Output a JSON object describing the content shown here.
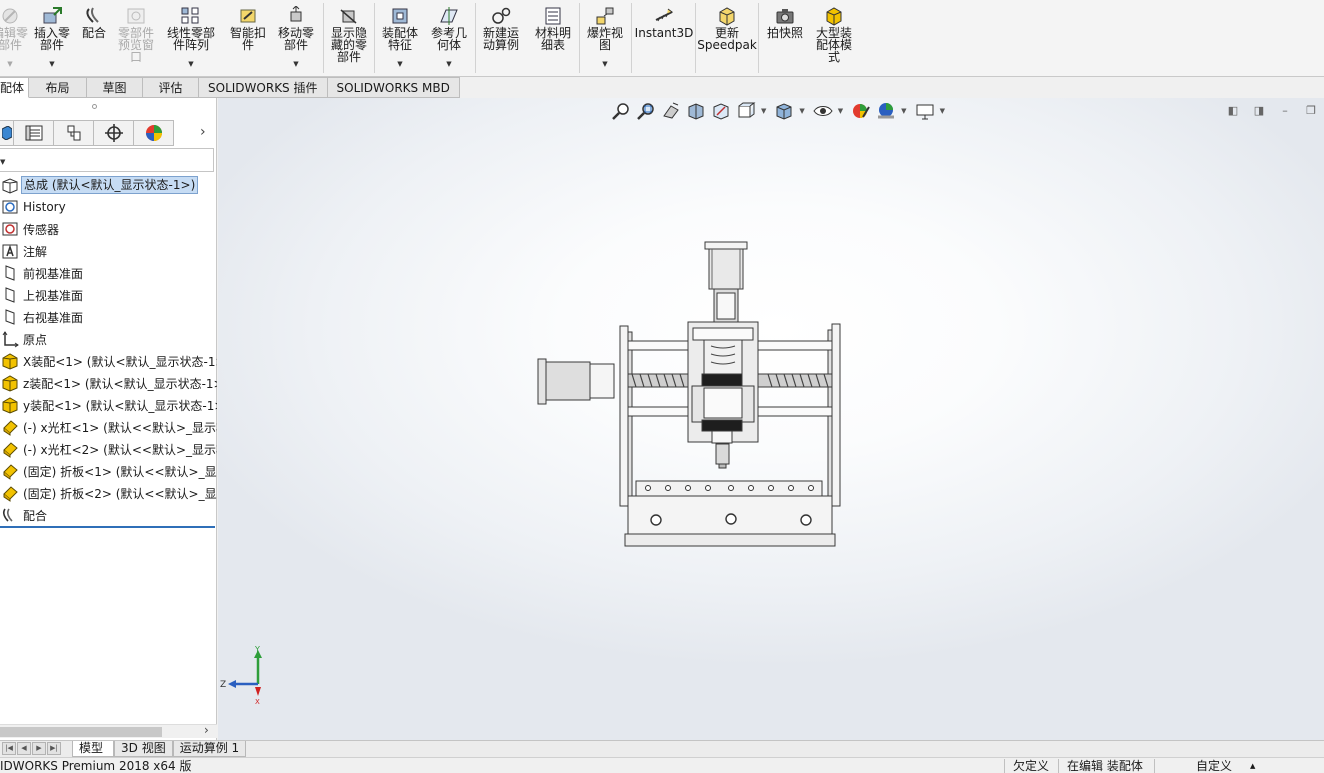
{
  "ribbon": {
    "buttons": [
      {
        "label": "编辑零\n部件",
        "icon": "edit-component-icon",
        "enabled": false
      },
      {
        "label": "插入零\n部件",
        "icon": "insert-component-icon",
        "enabled": true
      },
      {
        "label": "配合",
        "icon": "mate-icon",
        "enabled": true
      },
      {
        "label": "零部件\n预览窗\n口",
        "icon": "component-preview-icon",
        "enabled": false
      },
      {
        "label": "线性零部\n件阵列",
        "icon": "linear-pattern-icon",
        "enabled": true
      },
      {
        "label": "智能扣\n件",
        "icon": "smart-fasteners-icon",
        "enabled": true
      },
      {
        "label": "移动零\n部件",
        "icon": "move-component-icon",
        "enabled": true
      },
      {
        "label": "显示隐\n藏的零\n部件",
        "icon": "show-hidden-icon",
        "enabled": true
      },
      {
        "label": "装配体\n特征",
        "icon": "assembly-features-icon",
        "enabled": true
      },
      {
        "label": "参考几\n何体",
        "icon": "reference-geometry-icon",
        "enabled": true
      },
      {
        "label": "新建运\n动算例",
        "icon": "new-motion-study-icon",
        "enabled": true
      },
      {
        "label": "材料明\n细表",
        "icon": "bill-of-materials-icon",
        "enabled": true
      },
      {
        "label": "爆炸视\n图",
        "icon": "exploded-view-icon",
        "enabled": true
      },
      {
        "label": "Instant3D",
        "icon": "instant3d-icon",
        "enabled": true
      },
      {
        "label": "更新\nSpeedpak",
        "icon": "update-speedpak-icon",
        "enabled": true
      },
      {
        "label": "拍快照",
        "icon": "snapshot-icon",
        "enabled": true
      },
      {
        "label": "大型装\n配体模\n式",
        "icon": "large-assembly-icon",
        "enabled": true
      }
    ],
    "tabs": [
      {
        "label": "配体",
        "active": true
      },
      {
        "label": "布局",
        "active": false
      },
      {
        "label": "草图",
        "active": false
      },
      {
        "label": "评估",
        "active": false
      },
      {
        "label": "SOLIDWORKS 插件",
        "active": false
      },
      {
        "label": "SOLIDWORKS MBD",
        "active": false
      }
    ]
  },
  "feature_manager": {
    "tabs": [
      "feature-tree-icon",
      "property-manager-icon",
      "configuration-manager-icon",
      "dimxpert-icon",
      "display-manager-icon"
    ],
    "tree": [
      {
        "label": "总成  (默认<默认_显示状态-1>)",
        "icon": "assembly-icon",
        "root": true
      },
      {
        "label": "History",
        "icon": "history-icon"
      },
      {
        "label": "传感器",
        "icon": "sensor-icon"
      },
      {
        "label": "注解",
        "icon": "annotation-icon"
      },
      {
        "label": "前视基准面",
        "icon": "plane-icon"
      },
      {
        "label": "上视基准面",
        "icon": "plane-icon"
      },
      {
        "label": "右视基准面",
        "icon": "plane-icon"
      },
      {
        "label": "原点",
        "icon": "origin-icon"
      },
      {
        "label": "X装配<1> (默认<默认_显示状态-1>",
        "icon": "subassembly-icon"
      },
      {
        "label": "z装配<1> (默认<默认_显示状态-1>",
        "icon": "subassembly-icon"
      },
      {
        "label": "y装配<1> (默认<默认_显示状态-1>",
        "icon": "subassembly-icon"
      },
      {
        "label": "(-) x光杠<1> (默认<<默认>_显示状",
        "icon": "part-icon"
      },
      {
        "label": "(-) x光杠<2> (默认<<默认>_显示状",
        "icon": "part-icon"
      },
      {
        "label": "(固定) 折板<1> (默认<<默认>_显示",
        "icon": "part-icon"
      },
      {
        "label": "(固定) 折板<2> (默认<<默认>_显示",
        "icon": "part-icon"
      },
      {
        "label": "配合",
        "icon": "mates-folder-icon"
      }
    ]
  },
  "triad": {
    "y": "Y",
    "z": "Z",
    "x": "X"
  },
  "model_tabs": [
    {
      "label": "模型",
      "active": true
    },
    {
      "label": "3D 视图",
      "active": false
    },
    {
      "label": "运动算例 1",
      "active": false
    }
  ],
  "status": {
    "product": "IDWORKS Premium 2018 x64 版",
    "definition": "欠定义",
    "editing": "在编辑 装配体",
    "units": "自定义"
  },
  "colors": {
    "accent": "#2f6fb8",
    "selection": "#c6dcf4",
    "assembly_yellow": "#f2c200"
  }
}
